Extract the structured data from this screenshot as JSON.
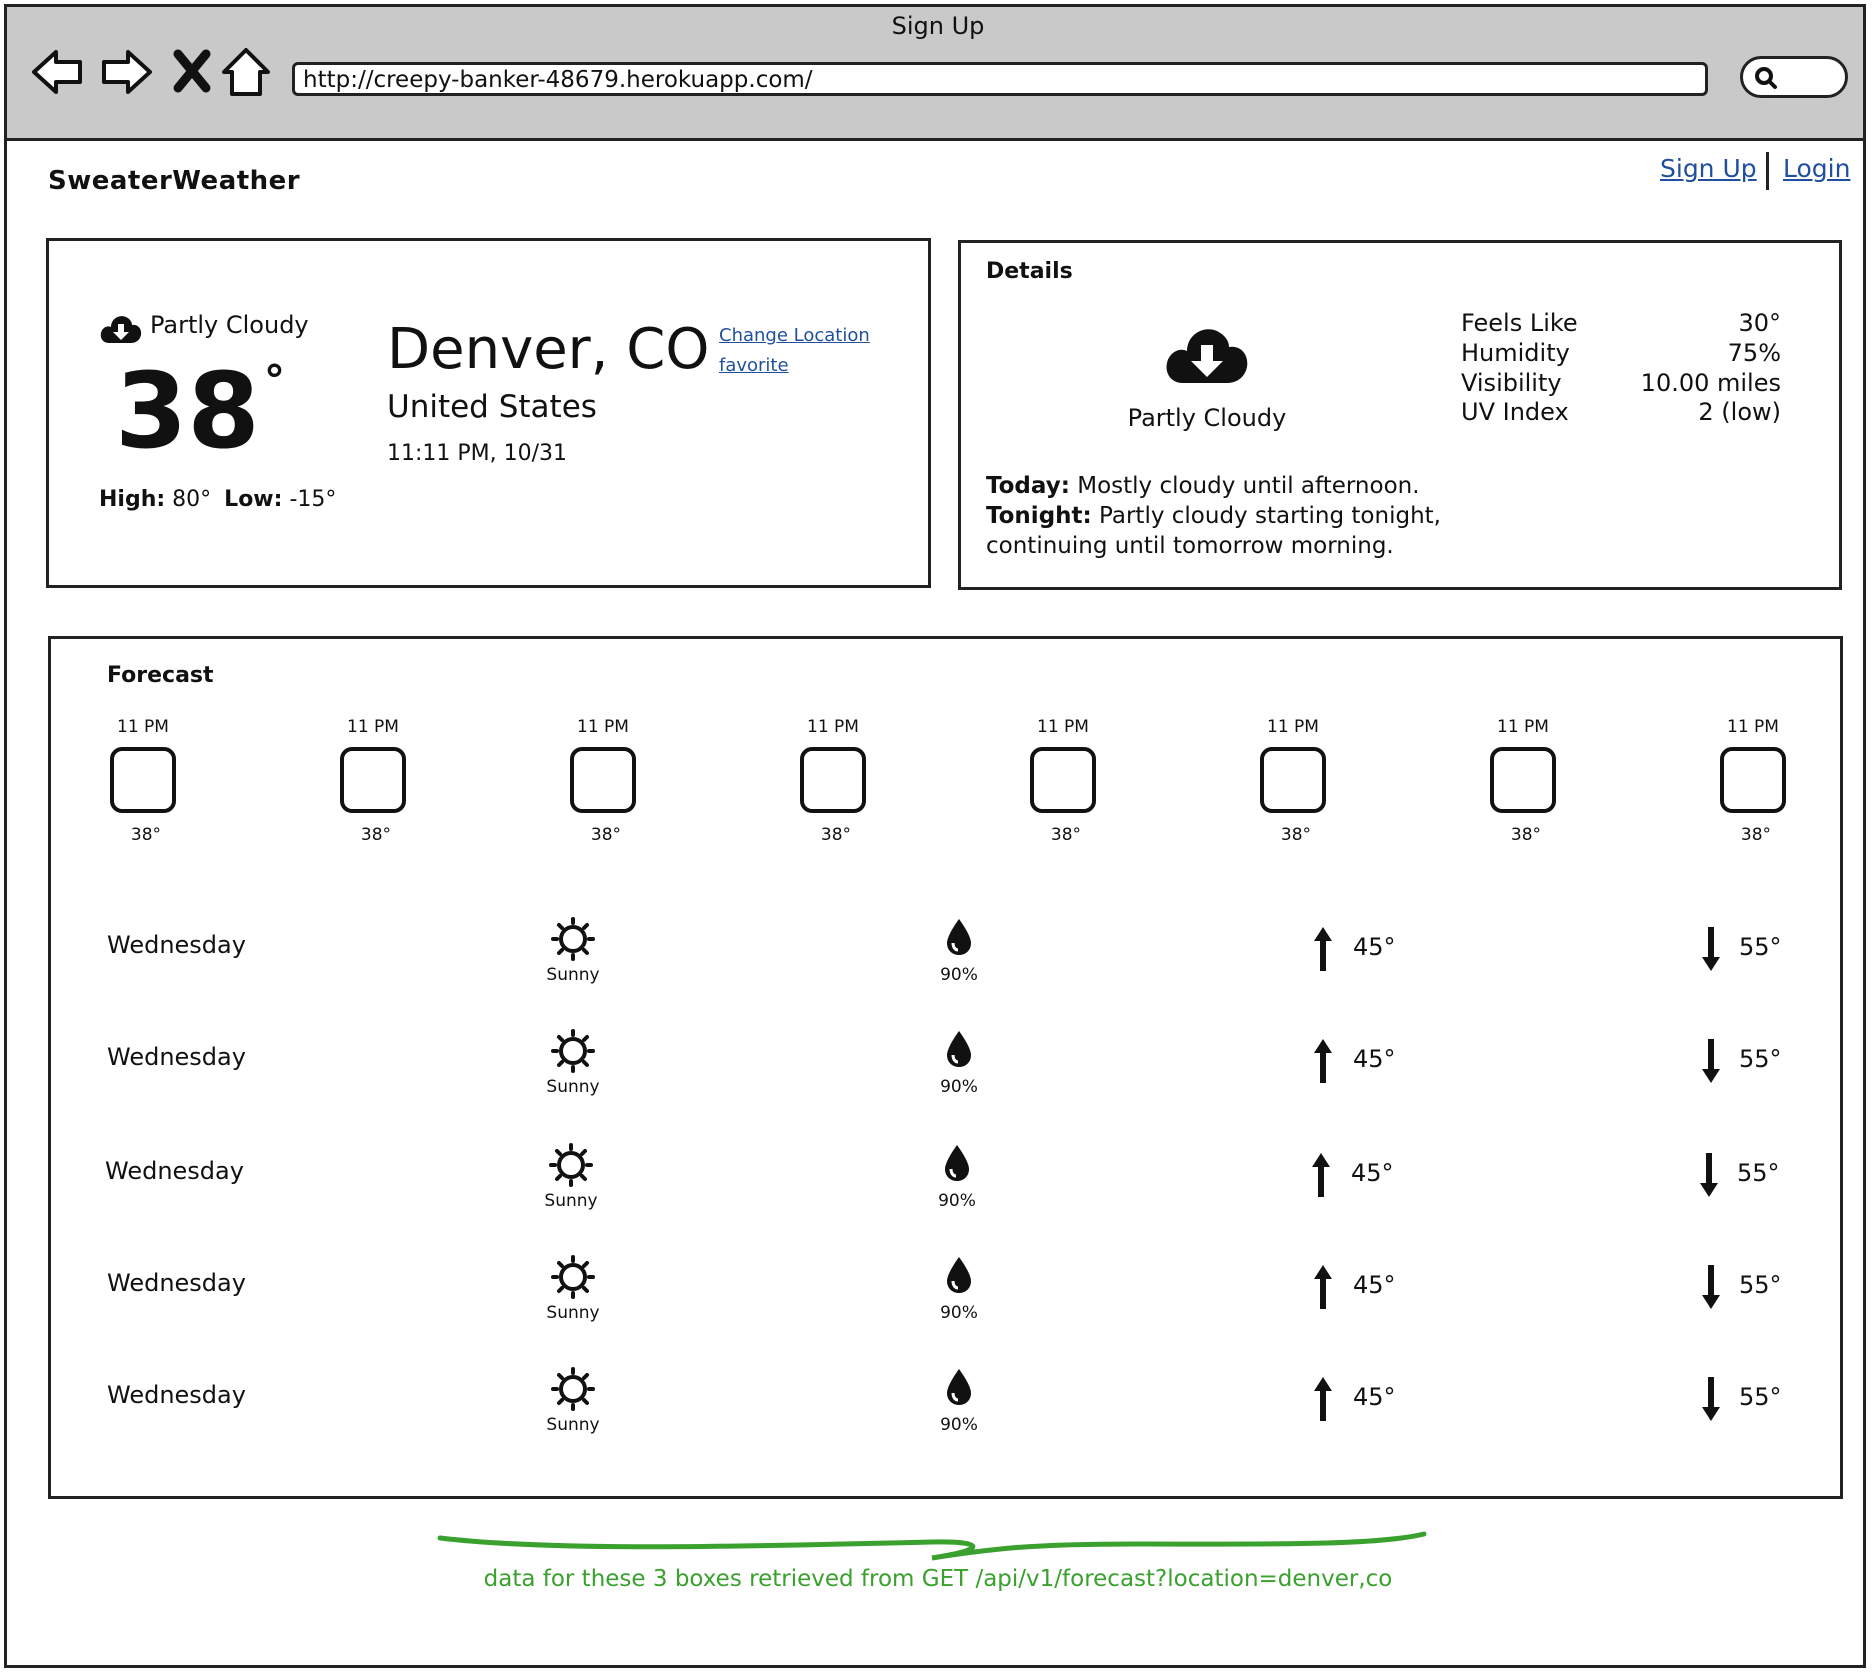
{
  "browser": {
    "window_title": "Sign Up",
    "url": "http://creepy-banker-48679.herokuapp.com/"
  },
  "header": {
    "brand": "SweaterWeather",
    "links": [
      "Sign Up",
      "Login"
    ]
  },
  "current": {
    "condition": "Partly Cloudy",
    "temperature": "38",
    "degree": "°",
    "high_label": "High:",
    "high": "80°",
    "low_label": "Low:",
    "low": "-15°",
    "city": "Denver, CO",
    "country": "United States",
    "datetime": "11:11 PM, 10/31",
    "change_location": "Change Location",
    "favorite": "favorite"
  },
  "details": {
    "title": "Details",
    "condition": "Partly Cloudy",
    "metrics": [
      {
        "label": "Feels Like",
        "value": "30°"
      },
      {
        "label": "Humidity",
        "value": "75%"
      },
      {
        "label": "Visibility",
        "value": "10.00 miles"
      },
      {
        "label": "UV Index",
        "value": "2 (low)"
      }
    ],
    "today_label": "Today:",
    "today_text": "Mostly cloudy until afternoon.",
    "tonight_label": "Tonight:",
    "tonight_text": "Partly cloudy starting tonight,",
    "tonight_text_2": "continuing until tomorrow morning."
  },
  "forecast": {
    "title": "Forecast",
    "hourly": [
      {
        "time": "11 PM",
        "temp": "38°"
      },
      {
        "time": "11 PM",
        "temp": "38°"
      },
      {
        "time": "11 PM",
        "temp": "38°"
      },
      {
        "time": "11 PM",
        "temp": "38°"
      },
      {
        "time": "11 PM",
        "temp": "38°"
      },
      {
        "time": "11 PM",
        "temp": "38°"
      },
      {
        "time": "11 PM",
        "temp": "38°"
      },
      {
        "time": "11 PM",
        "temp": "38°"
      }
    ],
    "daily": [
      {
        "day": "Wednesday",
        "summary": "Sunny",
        "precip": "90%",
        "high": "45°",
        "low": "55°"
      },
      {
        "day": "Wednesday",
        "summary": "Sunny",
        "precip": "90%",
        "high": "45°",
        "low": "55°"
      },
      {
        "day": "Wednesday",
        "summary": "Sunny",
        "precip": "90%",
        "high": "45°",
        "low": "55°"
      },
      {
        "day": "Wednesday",
        "summary": "Sunny",
        "precip": "90%",
        "high": "45°",
        "low": "55°"
      },
      {
        "day": "Wednesday",
        "summary": "Sunny",
        "precip": "90%",
        "high": "45°",
        "low": "55°"
      }
    ]
  },
  "annotation": {
    "text": "data for these 3 boxes retrieved from GET /api/v1/forecast?location=denver,co",
    "color": "#3aa02e"
  },
  "icons": {
    "nav": [
      "back-arrow-icon",
      "forward-arrow-icon",
      "close-icon",
      "home-icon"
    ],
    "weather": [
      "cloud-download-icon",
      "sun-icon",
      "raindrop-icon",
      "arrow-up-icon",
      "arrow-down-icon"
    ]
  }
}
